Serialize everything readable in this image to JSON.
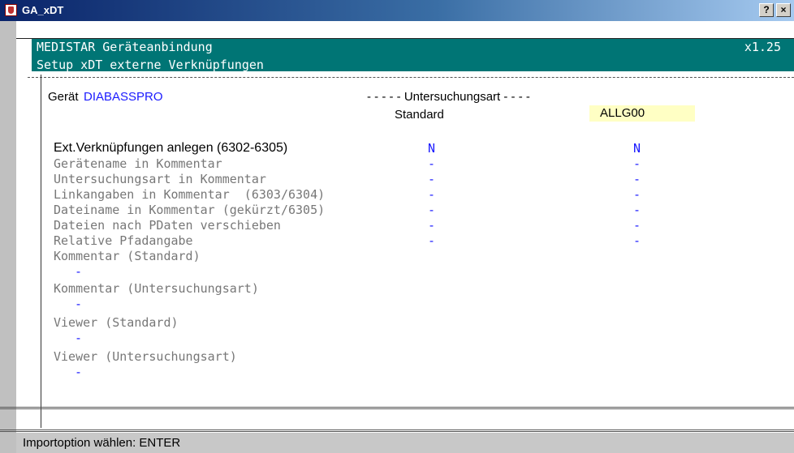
{
  "window": {
    "title": "GA_xDT",
    "help_label": "?",
    "close_label": "×"
  },
  "header": {
    "app_name": "MEDISTAR Geräteanbindung",
    "version": "x1.25",
    "subtitle": "Setup xDT externe Verknüpfungen"
  },
  "device": {
    "label": "Gerät",
    "name": "DIABASSPRO"
  },
  "columns": {
    "group_title": "- - - - - Untersuchungsart - - - -",
    "standard": "Standard",
    "selected_type": "ALLG00"
  },
  "rows": [
    {
      "label": "Ext.Verknüpfungen anlegen (6302-6305)",
      "standard": "N",
      "type": "N"
    },
    {
      "label": "Gerätename in Kommentar",
      "standard": "-",
      "type": "-"
    },
    {
      "label": "Untersuchungsart in Kommentar",
      "standard": "-",
      "type": "-"
    },
    {
      "label": "Linkangaben in Kommentar  (6303/6304)",
      "standard": "-",
      "type": "-"
    },
    {
      "label": "Dateiname in Kommentar (gekürzt/6305)",
      "standard": "-",
      "type": "-"
    },
    {
      "label": "Dateien nach PDaten verschieben",
      "standard": "-",
      "type": "-"
    },
    {
      "label": "Relative Pfadangabe",
      "standard": "-",
      "type": "-"
    }
  ],
  "text_fields": [
    {
      "label": "Kommentar (Standard)",
      "value": "-"
    },
    {
      "label": "Kommentar (Untersuchungsart)",
      "value": "-"
    },
    {
      "label": "Viewer (Standard)",
      "value": "-"
    },
    {
      "label": "Viewer (Untersuchungsart)",
      "value": "-"
    }
  ],
  "status": {
    "text": "Importoption wählen: ENTER"
  },
  "colors": {
    "header_bg": "#007575",
    "value_blue": "#1a1aff",
    "highlight": "#ffffc4"
  }
}
